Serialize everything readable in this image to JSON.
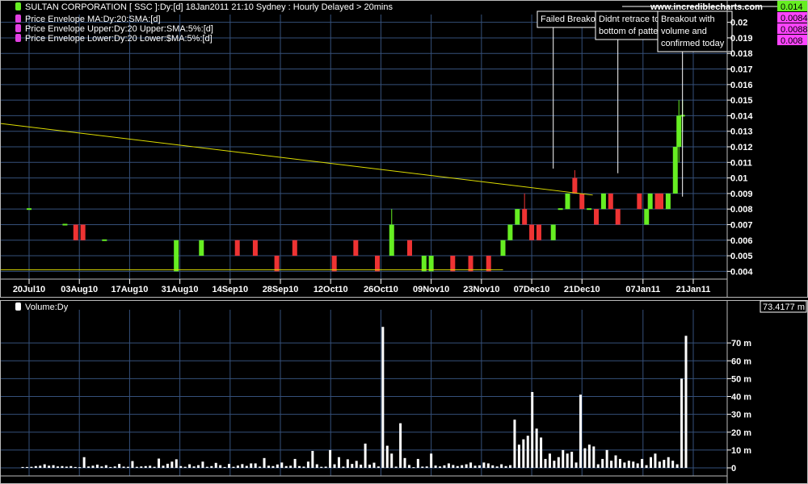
{
  "header": {
    "title": "SULTAN CORPORATION [ SSC ]:Dy:[d]  18Jan2011 21:10 Sydney : Hourly Delayed > 20mins",
    "website": "www.incrediblecharts.com"
  },
  "legend": [
    {
      "label": "Price Envelope MA:Dy:20:SMA:[d]",
      "color": "#e040e0"
    },
    {
      "label": "Price Envelope Upper:Dy:20 Upper:SMA:5%:[d]",
      "color": "#e040e0"
    },
    {
      "label": "Price Envelope Lower:Dy:20 Lower:$MA:5%:[d]",
      "color": "#e040e0"
    }
  ],
  "annotations": [
    {
      "lines": [
        "Failed Breakout"
      ],
      "date": "13Dec10",
      "value": 0.0106
    },
    {
      "lines": [
        "Didnt retrace to",
        "bottom of pattern"
      ],
      "date": "31Dec10",
      "value": 0.0103
    },
    {
      "lines": [
        "Breakout with",
        "volume and",
        "confirmed today"
      ],
      "date": "18Jan11",
      "value": 0.0088
    }
  ],
  "colors": {
    "up": "#66ee22",
    "down": "#ee3333",
    "trend": "#dddd00",
    "grid": "#35507a",
    "volume": "#ffffff"
  },
  "chart_data": [
    {
      "type": "bar",
      "title": "SULTAN CORPORATION [ SSC ]",
      "x_ticks": [
        "20Jul10",
        "03Aug10",
        "17Aug10",
        "31Aug10",
        "14Sep10",
        "28Sep10",
        "12Oct10",
        "26Oct10",
        "09Nov10",
        "23Nov10",
        "07Dec10",
        "21Dec10",
        "07Jan11",
        "21Jan11"
      ],
      "y_ticks": [
        0.004,
        0.005,
        0.006,
        0.007,
        0.008,
        0.009,
        0.01,
        0.011,
        0.012,
        0.013,
        0.014,
        0.015,
        0.016,
        0.017,
        0.018,
        0.019,
        0.02
      ],
      "ylim": [
        0.0035,
        0.0205
      ],
      "price_labels": [
        {
          "text": "0.014",
          "color": "#66ee22"
        },
        {
          "text": "0.0084",
          "color": "#ff44ff"
        },
        {
          "text": "0.0088",
          "color": "#ff44ff"
        },
        {
          "text": "0.008",
          "color": "#ff44ff"
        }
      ],
      "trendline": [
        {
          "date": "18Jul10",
          "value": 0.0135
        },
        {
          "date": "24Dec10",
          "value": 0.0089
        }
      ],
      "support_line": [
        {
          "date": "18Jul10",
          "value": 0.0041
        },
        {
          "date": "29Nov10",
          "value": 0.0041
        }
      ],
      "series": [
        {
          "date": "20Jul10",
          "open": 0.008,
          "close": 0.008,
          "high": 0.008,
          "low": 0.008
        },
        {
          "date": "30Jul10",
          "open": 0.007,
          "close": 0.007,
          "high": 0.007,
          "low": 0.007
        },
        {
          "date": "02Aug10",
          "open": 0.007,
          "close": 0.006,
          "high": 0.007,
          "low": 0.006
        },
        {
          "date": "04Aug10",
          "open": 0.007,
          "close": 0.006,
          "high": 0.007,
          "low": 0.006
        },
        {
          "date": "10Aug10",
          "open": 0.006,
          "close": 0.006,
          "high": 0.006,
          "low": 0.006
        },
        {
          "date": "30Aug10",
          "open": 0.004,
          "close": 0.006,
          "high": 0.006,
          "low": 0.004
        },
        {
          "date": "06Sep10",
          "open": 0.005,
          "close": 0.006,
          "high": 0.006,
          "low": 0.005
        },
        {
          "date": "16Sep10",
          "open": 0.006,
          "close": 0.005,
          "high": 0.006,
          "low": 0.005
        },
        {
          "date": "21Sep10",
          "open": 0.006,
          "close": 0.005,
          "high": 0.006,
          "low": 0.005
        },
        {
          "date": "27Sep10",
          "open": 0.005,
          "close": 0.004,
          "high": 0.005,
          "low": 0.004
        },
        {
          "date": "02Oct10",
          "open": 0.006,
          "close": 0.005,
          "high": 0.006,
          "low": 0.005
        },
        {
          "date": "13Oct10",
          "open": 0.005,
          "close": 0.004,
          "high": 0.005,
          "low": 0.004
        },
        {
          "date": "19Oct10",
          "open": 0.006,
          "close": 0.005,
          "high": 0.006,
          "low": 0.005
        },
        {
          "date": "25Oct10",
          "open": 0.005,
          "close": 0.004,
          "high": 0.005,
          "low": 0.004
        },
        {
          "date": "29Oct10",
          "open": 0.005,
          "close": 0.007,
          "high": 0.008,
          "low": 0.005
        },
        {
          "date": "03Nov10",
          "open": 0.006,
          "close": 0.005,
          "high": 0.006,
          "low": 0.005
        },
        {
          "date": "07Nov10",
          "open": 0.004,
          "close": 0.005,
          "high": 0.005,
          "low": 0.004
        },
        {
          "date": "09Nov10",
          "open": 0.004,
          "close": 0.005,
          "high": 0.005,
          "low": 0.004
        },
        {
          "date": "15Nov10",
          "open": 0.005,
          "close": 0.004,
          "high": 0.005,
          "low": 0.004
        },
        {
          "date": "20Nov10",
          "open": 0.005,
          "close": 0.004,
          "high": 0.005,
          "low": 0.004
        },
        {
          "date": "25Nov10",
          "open": 0.005,
          "close": 0.004,
          "high": 0.005,
          "low": 0.004
        },
        {
          "date": "29Nov10",
          "open": 0.005,
          "close": 0.006,
          "high": 0.006,
          "low": 0.005
        },
        {
          "date": "01Dec10",
          "open": 0.006,
          "close": 0.007,
          "high": 0.007,
          "low": 0.006
        },
        {
          "date": "03Dec10",
          "open": 0.007,
          "close": 0.008,
          "high": 0.008,
          "low": 0.007
        },
        {
          "date": "05Dec10",
          "open": 0.008,
          "close": 0.007,
          "high": 0.009,
          "low": 0.007
        },
        {
          "date": "07Dec10",
          "open": 0.007,
          "close": 0.006,
          "high": 0.007,
          "low": 0.006
        },
        {
          "date": "09Dec10",
          "open": 0.007,
          "close": 0.006,
          "high": 0.007,
          "low": 0.006
        },
        {
          "date": "13Dec10",
          "open": 0.006,
          "close": 0.007,
          "high": 0.007,
          "low": 0.006
        },
        {
          "date": "15Dec10",
          "open": 0.008,
          "close": 0.008,
          "high": 0.008,
          "low": 0.008
        },
        {
          "date": "17Dec10",
          "open": 0.008,
          "close": 0.009,
          "high": 0.009,
          "low": 0.008
        },
        {
          "date": "19Dec10",
          "open": 0.01,
          "close": 0.009,
          "high": 0.0105,
          "low": 0.009
        },
        {
          "date": "21Dec10",
          "open": 0.009,
          "close": 0.008,
          "high": 0.009,
          "low": 0.008
        },
        {
          "date": "23Dec10",
          "open": 0.008,
          "close": 0.008,
          "high": 0.008,
          "low": 0.008
        },
        {
          "date": "25Dec10",
          "open": 0.008,
          "close": 0.007,
          "high": 0.008,
          "low": 0.007
        },
        {
          "date": "27Dec10",
          "open": 0.008,
          "close": 0.009,
          "high": 0.009,
          "low": 0.008
        },
        {
          "date": "29Dec10",
          "open": 0.009,
          "close": 0.008,
          "high": 0.009,
          "low": 0.008
        },
        {
          "date": "31Dec10",
          "open": 0.008,
          "close": 0.007,
          "high": 0.008,
          "low": 0.007
        },
        {
          "date": "06Jan11",
          "open": 0.009,
          "close": 0.008,
          "high": 0.009,
          "low": 0.008
        },
        {
          "date": "08Jan11",
          "open": 0.007,
          "close": 0.008,
          "high": 0.008,
          "low": 0.007
        },
        {
          "date": "09Jan11",
          "open": 0.008,
          "close": 0.009,
          "high": 0.009,
          "low": 0.008
        },
        {
          "date": "11Jan11",
          "open": 0.009,
          "close": 0.008,
          "high": 0.009,
          "low": 0.008
        },
        {
          "date": "12Jan11",
          "open": 0.009,
          "close": 0.008,
          "high": 0.009,
          "low": 0.008
        },
        {
          "date": "14Jan11",
          "open": 0.008,
          "close": 0.009,
          "high": 0.009,
          "low": 0.008
        },
        {
          "date": "16Jan11",
          "open": 0.009,
          "close": 0.012,
          "high": 0.012,
          "low": 0.009
        },
        {
          "date": "17Jan11",
          "open": 0.012,
          "close": 0.014,
          "high": 0.015,
          "low": 0.011
        },
        {
          "date": "18Jan11",
          "open": 0.014,
          "close": 0.014,
          "high": 0.015,
          "low": 0.013
        }
      ]
    },
    {
      "type": "bar",
      "title": "Volume:Dy",
      "current_value": "73.4177 m",
      "y_ticks": [
        0,
        10,
        20,
        30,
        40,
        50,
        60,
        70
      ],
      "y_tick_labels": [
        "0",
        "10 m",
        "20 m",
        "30 m",
        "40 m",
        "50 m",
        "60 m",
        "70 m"
      ],
      "ylim": [
        0,
        80
      ],
      "values": [
        0.5,
        0.5,
        0.6,
        1,
        1.2,
        2,
        1.2,
        1.5,
        0.8,
        1,
        0.7,
        1,
        0.5,
        0.4,
        6,
        0.8,
        1.2,
        1.8,
        0.8,
        1.5,
        0.5,
        0.8,
        2.2,
        0.7,
        0.6,
        3.8,
        0.6,
        0.8,
        1,
        1.2,
        0.6,
        5.2,
        1.2,
        2.3,
        3.5,
        4.8,
        1,
        0.6,
        2,
        0.8,
        1.5,
        3.5,
        0.6,
        1,
        2.8,
        1.5,
        0.5,
        2.2,
        0.6,
        1.3,
        2.1,
        1.1,
        2.5,
        2.5,
        0.7,
        5.5,
        1.2,
        1,
        1.9,
        3,
        1,
        1.2,
        5,
        1,
        0.7,
        3.5,
        9.5,
        2,
        0.6,
        0.7,
        10,
        2,
        6,
        0.7,
        4.8,
        2.2,
        3.9,
        1.8,
        13.6,
        1.8,
        2.9,
        0.8,
        79,
        12.4,
        8,
        0.7,
        25,
        5.5,
        1.6,
        0.4,
        5,
        0.7,
        0.8,
        8,
        1.3,
        0.8,
        1.4,
        2.5,
        1.6,
        1,
        1.5,
        2,
        3,
        1.2,
        1.4,
        3,
        2.5,
        1.4,
        0.8,
        2,
        1,
        1.5,
        27,
        13,
        16,
        18,
        42.5,
        22,
        17,
        5,
        8,
        4,
        6,
        10,
        8,
        9,
        3,
        41,
        11,
        13,
        12,
        2,
        5,
        10,
        4,
        7,
        5,
        3,
        4,
        3.5,
        2.5,
        5,
        1.5,
        6,
        8,
        3.5,
        4.5,
        6,
        4,
        2,
        50,
        74
      ]
    }
  ]
}
